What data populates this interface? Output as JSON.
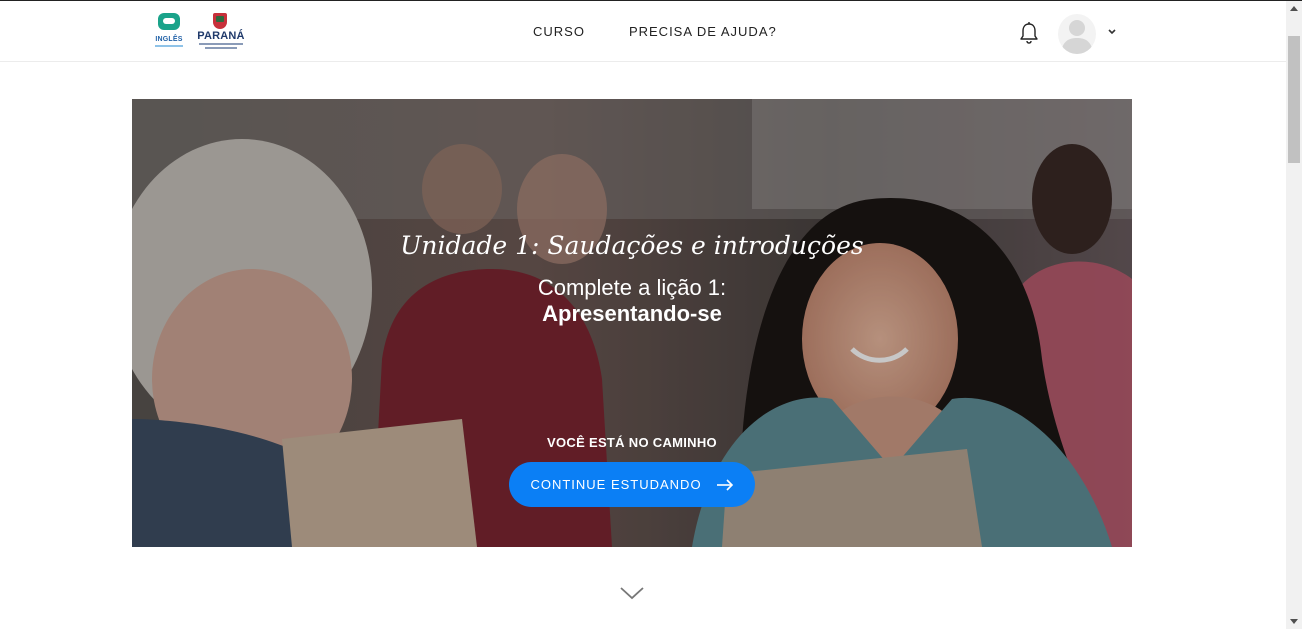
{
  "header": {
    "logo_ingles_text": "INGLÊS",
    "logo_parana_text": "PARANÁ",
    "nav": [
      {
        "label": "CURSO"
      },
      {
        "label": "PRECISA DE AJUDA?"
      }
    ]
  },
  "hero": {
    "title": "Unidade 1: Saudações e introduções",
    "subtitle": "Complete a lição 1:",
    "lesson": "Apresentando-se",
    "progress_text": "VOCÊ ESTÁ NO CAMINHO",
    "cta_label": "CONTINUE ESTUDANDO"
  },
  "colors": {
    "accent": "#0b7ff5",
    "logo_green": "#1aa38a",
    "logo_blue": "#2262a8"
  },
  "icons": [
    "bell-icon",
    "avatar-icon",
    "chevron-down-icon",
    "arrow-right-icon",
    "scroll-down-chevron-icon"
  ]
}
